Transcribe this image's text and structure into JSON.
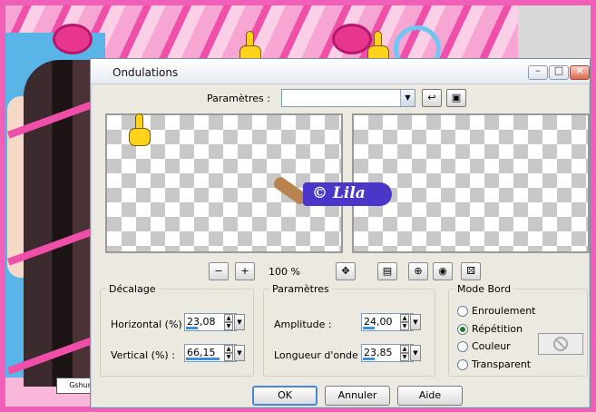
{
  "window": {
    "title": "Ondulations"
  },
  "presets": {
    "label": "Paramètres :",
    "value": ""
  },
  "zoom": {
    "level": "100 %"
  },
  "watermark": {
    "text": "© Lila"
  },
  "decalage": {
    "legend": "Décalage",
    "horizontal": {
      "label": "Horizontal (%) :",
      "value": "23,08",
      "fill": 0.2308
    },
    "vertical": {
      "label": "Vertical (%) :",
      "value": "66,15",
      "fill": 0.6615
    }
  },
  "parametres": {
    "legend": "Paramètres",
    "amplitude": {
      "label": "Amplitude :",
      "value": "24,00",
      "fill": 0.24
    },
    "longueur": {
      "label": "Longueur d'onde :",
      "value": "23,85",
      "fill": 0.2385
    }
  },
  "mode_bord": {
    "legend": "Mode Bord",
    "options": [
      {
        "label": "Enroulement",
        "selected": false
      },
      {
        "label": "Répétition",
        "selected": true
      },
      {
        "label": "Couleur",
        "selected": false
      },
      {
        "label": "Transparent",
        "selected": false
      }
    ]
  },
  "buttons": {
    "ok": "OK",
    "cancel": "Annuler",
    "help": "Aide"
  },
  "background": {
    "logo_text": "Gshun"
  },
  "colors": {
    "accent": "#3d8fe0",
    "frame": "#f05fb8",
    "dialog": "#ece9e0"
  }
}
